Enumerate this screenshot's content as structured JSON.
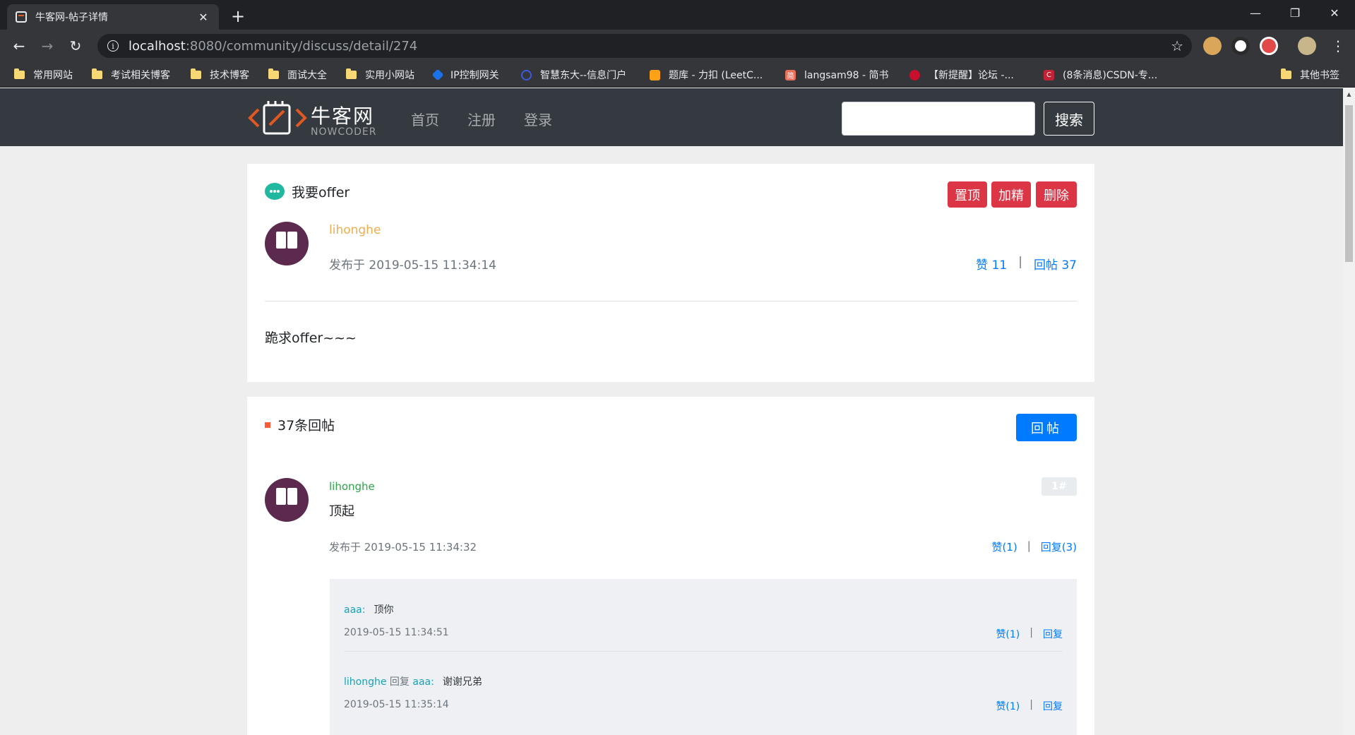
{
  "browser": {
    "tab_title": "牛客网-帖子详情",
    "tab_close": "✕",
    "new_tab": "+",
    "url_host": "localhost",
    "url_path": ":8080/community/discuss/detail/274",
    "window_minimize": "—",
    "window_restore": "❐",
    "window_close": "✕",
    "back": "←",
    "forward": "→",
    "reload": "↻",
    "star": "☆",
    "menu": "⋮",
    "bookmarks": [
      {
        "label": "常用网站",
        "icon": "folder-icon"
      },
      {
        "label": "考试相关博客",
        "icon": "folder-icon"
      },
      {
        "label": "技术博客",
        "icon": "folder-icon"
      },
      {
        "label": "面试大全",
        "icon": "folder-icon"
      },
      {
        "label": "实用小网站",
        "icon": "folder-icon"
      },
      {
        "label": "IP控制网关",
        "icon": "diamond-icon"
      },
      {
        "label": "智慧东大--信息门户",
        "icon": "c-icon"
      },
      {
        "label": "题库 - 力扣 (LeetC...",
        "icon": "leetcode-icon"
      },
      {
        "label": "langsam98 - 简书",
        "icon": "jianshu-icon"
      },
      {
        "label": "【新提醒】论坛 -...",
        "icon": "forum-icon"
      },
      {
        "label": "(8条消息)CSDN-专...",
        "icon": "csdn-icon"
      }
    ],
    "other_bookmarks": "其他书签"
  },
  "header": {
    "logo_text": "牛客网",
    "logo_sub": "NOWCODER",
    "nav": [
      "首页",
      "注册",
      "登录"
    ],
    "search_button": "搜索",
    "search_value": ""
  },
  "post": {
    "title": "我要offer",
    "actions": [
      "置顶",
      "加精",
      "删除"
    ],
    "author": "lihonghe",
    "time": "发布于 2019-05-15 11:34:14",
    "likes": "赞 11",
    "separator": "|",
    "replies": "回帖 37",
    "content": "跪求offer~~~"
  },
  "replies_section": {
    "title": "37条回帖",
    "reply_button": "回帖",
    "comments": [
      {
        "author": "lihonghe",
        "floor": "1#",
        "content": "顶起",
        "time": "发布于 2019-05-15 11:34:32",
        "likes": "赞(1)",
        "replies": "回复(3)",
        "sub_replies": [
          {
            "user": "aaa:",
            "reply_word": "",
            "target": "",
            "text": "顶你",
            "time": "2019-05-15 11:34:51",
            "likes": "赞(1)",
            "reply": "回复"
          },
          {
            "user": "lihonghe",
            "reply_word": " 回复 ",
            "target": "aaa:",
            "text": "谢谢兄弟",
            "time": "2019-05-15 11:35:14",
            "likes": "赞(1)",
            "reply": "回复"
          }
        ]
      }
    ]
  },
  "colors": {
    "nav_bg": "#343a40",
    "danger": "#dc3545",
    "primary": "#007bff",
    "author_orange": "#f0ad4e",
    "comment_author_green": "#28a745",
    "accent_square": "#ff5a36",
    "chat_icon": "#20b99f"
  }
}
